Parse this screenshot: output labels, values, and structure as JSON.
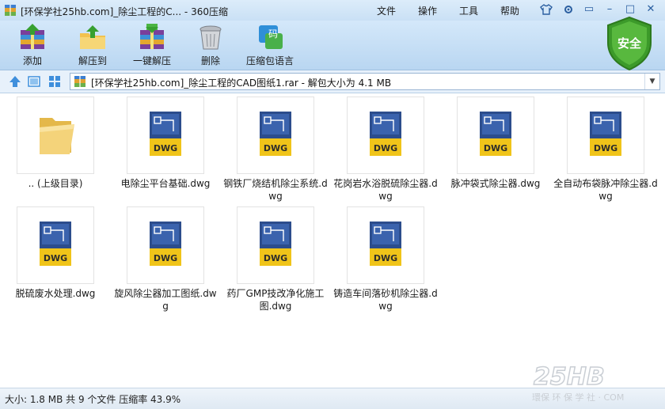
{
  "window": {
    "title": "[环保学社25hb.com]_除尘工程的C... - 360压缩",
    "menus": [
      "文件",
      "操作",
      "工具",
      "帮助"
    ],
    "controls": [
      "▭",
      "–",
      "□",
      "✕"
    ]
  },
  "toolbar": {
    "add_label": "添加",
    "extract_to_label": "解压到",
    "one_click_label": "一键解压",
    "delete_label": "删除",
    "zip_password_label": "压缩包语言",
    "shield_label": "安全",
    "code_badge": "码"
  },
  "nav": {
    "path": "[环保学社25hb.com]_除尘工程的CAD图纸1.rar - 解包大小为 4.1 MB"
  },
  "files": [
    {
      "name": ".. (上级目录)",
      "type": "folder"
    },
    {
      "name": "电除尘平台基础.dwg",
      "type": "dwg"
    },
    {
      "name": "钢铁厂烧结机除尘系统.dwg",
      "type": "dwg"
    },
    {
      "name": "花岗岩水浴脱硫除尘器.dwg",
      "type": "dwg"
    },
    {
      "name": "脉冲袋式除尘器.dwg",
      "type": "dwg"
    },
    {
      "name": "全自动布袋脉冲除尘器.dwg",
      "type": "dwg"
    },
    {
      "name": "脱硫废水处理.dwg",
      "type": "dwg"
    },
    {
      "name": "旋风除尘器加工图纸.dwg",
      "type": "dwg"
    },
    {
      "name": "药厂GMP技改净化施工图.dwg",
      "type": "dwg"
    },
    {
      "name": "铸造车间落砂机除尘器.dwg",
      "type": "dwg"
    }
  ],
  "dwg_label": "DWG",
  "status": {
    "text": "大小: 1.8 MB 共 9 个文件 压缩率 43.9%"
  },
  "watermark": {
    "brand": "25HB",
    "tagline": "環保 环 保 学 社 · COM"
  },
  "icons": {
    "app": "archive-app-icon",
    "shirt": "skin-icon",
    "settings": "settings-icon",
    "up": "up-arrow-icon",
    "view_large": "large-view-icon",
    "view_grid": "grid-view-icon"
  }
}
